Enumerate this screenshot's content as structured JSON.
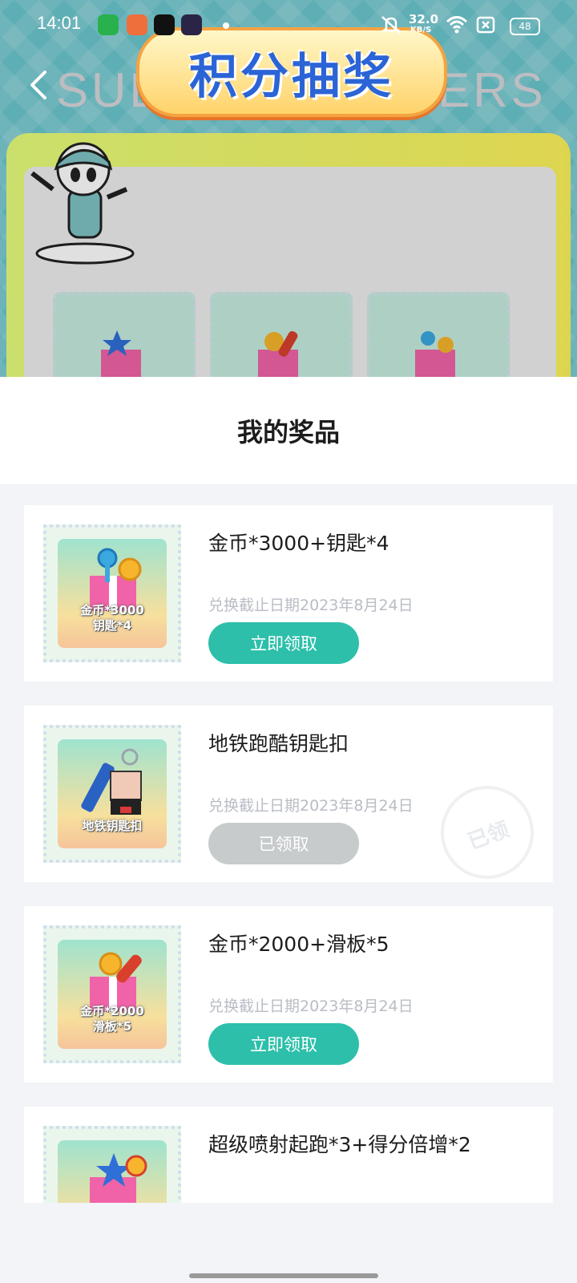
{
  "status_bar": {
    "time": "14:01",
    "net_speed_value": "32.0",
    "net_speed_unit": "KB/S",
    "battery": "48",
    "icons": [
      "app-store-icon",
      "game-center-icon",
      "tiktok-icon",
      "app-icon",
      "mute-icon",
      "wifi-icon",
      "sim-icon",
      "battery-icon"
    ]
  },
  "banner": {
    "title": "积分抽奖",
    "watermark": "SUBWAY SURFERS",
    "back_icon": "chevron-left-icon"
  },
  "sheet": {
    "title": "我的奖品"
  },
  "prizes": [
    {
      "title": "金币*3000+钥匙*4",
      "thumb_label_line1": "金币*3000",
      "thumb_label_line2": "钥匙*4",
      "deadline": "兑换截止日期2023年8月24日",
      "button": "立即领取",
      "claimed": false,
      "icon": "gift-key-coin-icon"
    },
    {
      "title": "地铁跑酷钥匙扣",
      "thumb_label_line1": "地铁钥匙扣",
      "thumb_label_line2": "",
      "deadline": "兑换截止日期2023年8月24日",
      "button": "已领取",
      "claimed": true,
      "stamp": "已领",
      "icon": "keychain-icon"
    },
    {
      "title": "金币*2000+滑板*5",
      "thumb_label_line1": "金币*2000",
      "thumb_label_line2": "滑板*5",
      "deadline": "兑换截止日期2023年8月24日",
      "button": "立即领取",
      "claimed": false,
      "icon": "gift-coin-board-icon"
    },
    {
      "title": "超级喷射起跑*3+得分倍增*2",
      "thumb_label_line1": "",
      "thumb_label_line2": "",
      "deadline": "",
      "button": "",
      "claimed": false,
      "icon": "gift-star-icon"
    }
  ],
  "colors": {
    "accent": "#2dbfaa",
    "disabled": "#c7cbcc",
    "deadline_text": "#b9bdc4",
    "background": "#f2f4f7"
  }
}
